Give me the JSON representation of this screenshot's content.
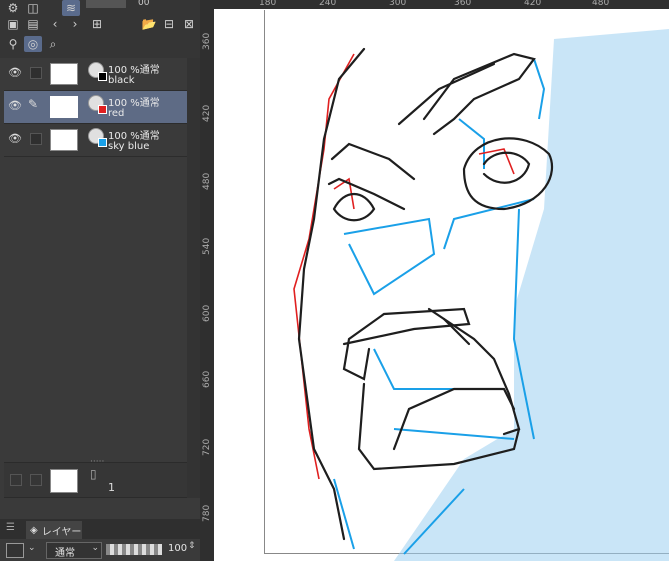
{
  "layers": [
    {
      "opacity": "100 %通常",
      "name": "black",
      "color": "#000000",
      "selected": false,
      "icon": "eye-icon"
    },
    {
      "opacity": "100 %通常",
      "name": "red",
      "color": "#e02020",
      "selected": true,
      "icon": "pencil-icon"
    },
    {
      "opacity": "100 %通常",
      "name": "sky blue",
      "color": "#1aa0e8",
      "selected": false,
      "icon": "eye-icon"
    }
  ],
  "bottom_layer": {
    "name": "1"
  },
  "tabs": {
    "layer_tab": "レイヤー"
  },
  "footer": {
    "blend_mode": "通常",
    "opacity_value": "100"
  },
  "rulers": {
    "top": [
      "180",
      "240",
      "300",
      "360",
      "420",
      "480"
    ],
    "left": [
      "360",
      "420",
      "480",
      "540",
      "600",
      "660",
      "720",
      "780"
    ]
  },
  "toolbar": {
    "zoom_value": "00"
  },
  "colors": {
    "selected_row": "#5e6b85",
    "panel_bg": "#3a3a3a",
    "canvas": "#ffffff"
  }
}
